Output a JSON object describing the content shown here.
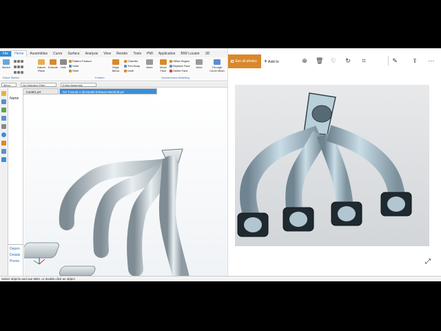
{
  "cad": {
    "tabs": [
      "File",
      "Home",
      "Assemblies",
      "Curve",
      "Surface",
      "Analysis",
      "View",
      "Render",
      "Tools",
      "PMI",
      "Application",
      "BIW Locator",
      "3D"
    ],
    "ribbon": {
      "sketch": "Sketch",
      "datum_plane": "Datum Plane",
      "extrude": "Extrude",
      "hole": "Hole",
      "pattern_feature": "Pattern Feature",
      "unite": "Unite",
      "shell": "Shell",
      "edge_blend": "Edge Blend",
      "chamfer": "Chamfer",
      "trim_body": "Trim Body",
      "draft": "Draft",
      "more1": "More",
      "move_face": "Move Face",
      "offset_region": "Offset Region",
      "replace_face": "Replace Face",
      "delete_face": "Delete Face",
      "more2": "More",
      "through_curve_mesh": "Through Curve Mesh",
      "group_direct_sketch": "Direct Sketch",
      "group_feature": "Feature",
      "group_synchronous": "Synchronous Modeling"
    },
    "toolbar2": {
      "menu": "Menu",
      "selection_filter": "No Selection Filter",
      "assembly": "Entire Assembly"
    },
    "doc_tabs": [
      "model1.prt",
      "NX Tutorial 4 3D Model Exhaust Manifold.prt"
    ],
    "nav": {
      "name": "Name",
      "items": [
        "Depen",
        "Details",
        "Previe"
      ]
    },
    "status": "Select objects and use MB3, or double-click an object"
  },
  "photos": {
    "see_all": "See all photos",
    "add_to": "Add to",
    "icons": [
      "zoom-icon",
      "delete-icon",
      "favorite-icon",
      "rotate-icon",
      "crop-icon",
      "edit-icon",
      "share-icon",
      "more-icon"
    ]
  }
}
